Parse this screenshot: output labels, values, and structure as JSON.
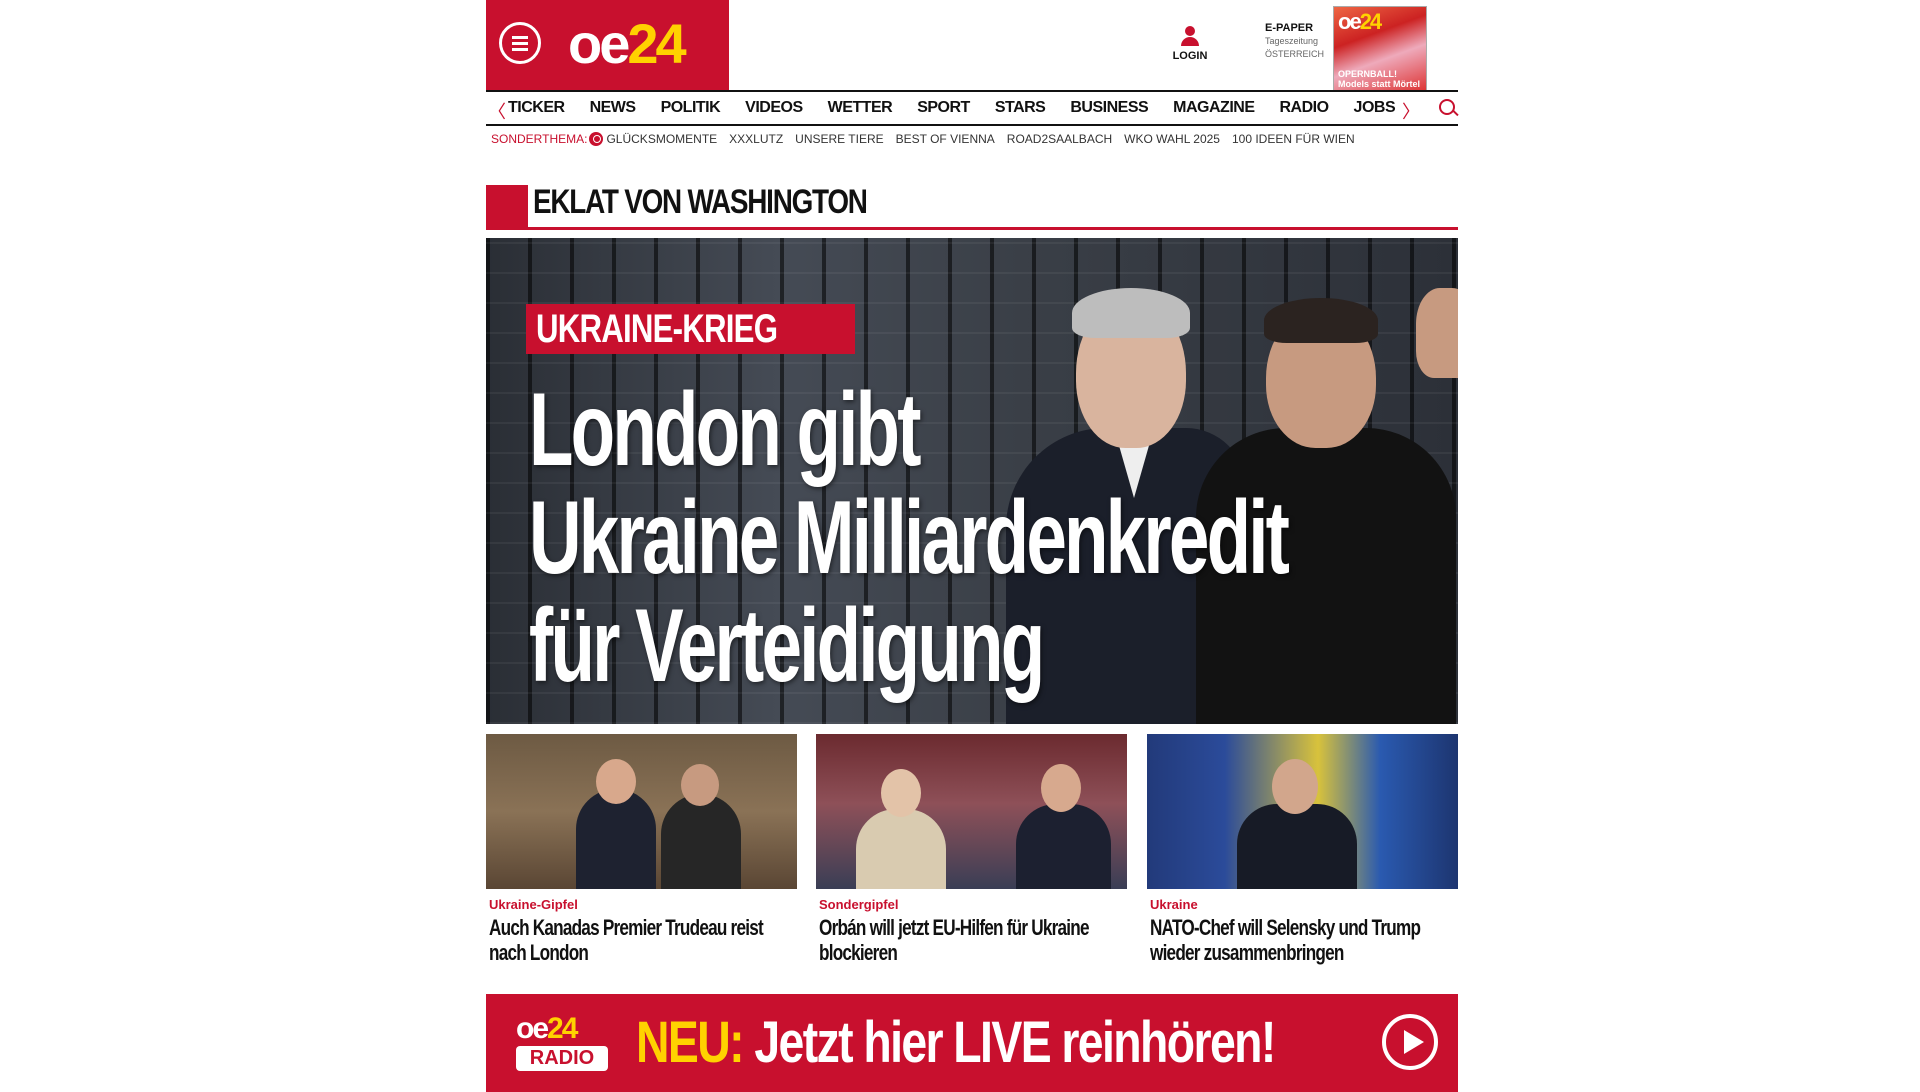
{
  "header": {
    "logo_main": "oe",
    "logo_accent": "24",
    "login_label": "LOGIN",
    "epaper_title": "E-PAPER",
    "epaper_sub1": "Tageszeitung",
    "epaper_sub2": "ÖSTERREICH",
    "cover_logo_main": "oe",
    "cover_logo_accent": "24",
    "cover_caption": "OPERNBALL! Models statt Mörtel"
  },
  "nav": {
    "items": [
      "TICKER",
      "NEWS",
      "POLITIK",
      "VIDEOS",
      "WETTER",
      "SPORT",
      "STARS",
      "BUSINESS",
      "MAGAZINE",
      "RADIO",
      "JOBS"
    ],
    "prev_arrow": "〈",
    "next_arrow": "〉"
  },
  "subnav": {
    "label": "SONDERTHEMA:",
    "items": [
      "GLÜCKSMOMENTE",
      "XXXLUTZ",
      "UNSERE TIERE",
      "BEST OF VIENNA",
      "ROAD2SAALBACH",
      "WKO WAHL 2025",
      "100 IDEEN FÜR WIEN"
    ]
  },
  "section": {
    "title": "EKLAT VON WASHINGTON"
  },
  "hero": {
    "kicker": "UKRAINE-KRIEG",
    "headline_lines": [
      "London gibt",
      "Ukraine Milliardenkredit",
      "für Verteidigung"
    ]
  },
  "teasers": [
    {
      "kicker": "Ukraine-Gipfel",
      "title": "Auch Kanadas Premier Trudeau reist nach London"
    },
    {
      "kicker": "Sondergipfel",
      "title": "Orbán will jetzt EU-Hilfen für Ukraine blockieren"
    },
    {
      "kicker": "Ukraine",
      "title": "NATO-Chef will Selensky und Trump wieder zusammenbringen"
    }
  ],
  "radio": {
    "logo_main": "oe",
    "logo_accent": "24",
    "logo_sub": "RADIO",
    "cta_prefix": "NEU:",
    "cta_text": " Jetzt hier LIVE reinhören!"
  },
  "colors": {
    "brand_red": "#c8102e",
    "accent_yellow": "#ffd200"
  }
}
